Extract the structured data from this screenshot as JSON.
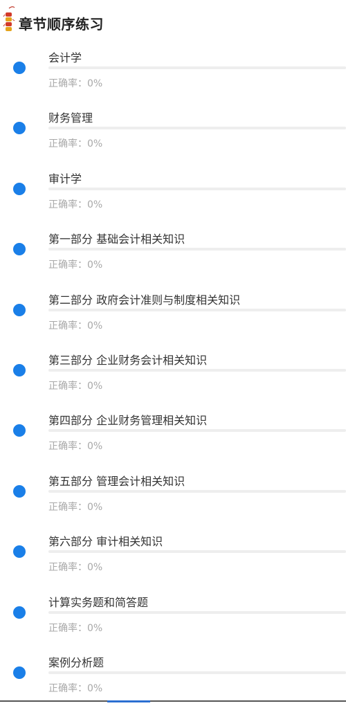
{
  "header": {
    "title": "章节顺序练习",
    "logo_icon": "firecracker-icon"
  },
  "accent_color": "#1a7fe8",
  "chapters": [
    {
      "title": "会计学",
      "accuracy_label": "正确率：0%",
      "progress": 0
    },
    {
      "title": "财务管理",
      "accuracy_label": "正确率：0%",
      "progress": 0
    },
    {
      "title": "审计学",
      "accuracy_label": "正确率：0%",
      "progress": 0
    },
    {
      "title": "第一部分 基础会计相关知识",
      "accuracy_label": "正确率：0%",
      "progress": 0
    },
    {
      "title": "第二部分 政府会计准则与制度相关知识",
      "accuracy_label": "正确率：0%",
      "progress": 0
    },
    {
      "title": "第三部分 企业财务会计相关知识",
      "accuracy_label": "正确率：0%",
      "progress": 0
    },
    {
      "title": "第四部分 企业财务管理相关知识",
      "accuracy_label": "正确率：0%",
      "progress": 0
    },
    {
      "title": "第五部分 管理会计相关知识",
      "accuracy_label": "正确率：0%",
      "progress": 0
    },
    {
      "title": "第六部分 审计相关知识",
      "accuracy_label": "正确率：0%",
      "progress": 0
    },
    {
      "title": "计算实务题和简答题",
      "accuracy_label": "正确率：0%",
      "progress": 0
    },
    {
      "title": "案例分析题",
      "accuracy_label": "正确率：0%",
      "progress": 0
    }
  ]
}
